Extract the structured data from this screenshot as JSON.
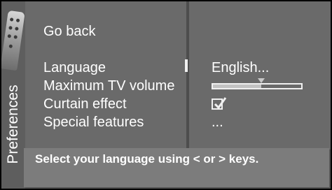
{
  "side_panel": {
    "title": "Preferences",
    "icon": "remote-control-icon"
  },
  "menu": {
    "go_back": "Go back",
    "items": [
      {
        "label": "Language",
        "value": "English..."
      },
      {
        "label": "Maximum TV volume",
        "value_level": 0.55
      },
      {
        "label": "Curtain effect",
        "checked": true
      },
      {
        "label": "Special features",
        "value": "..."
      }
    ]
  },
  "help_text": "Select your language using < or > keys.",
  "colors": {
    "panel": "#6a6a6a",
    "help_bar": "#7c7c7c",
    "text": "#ffffff"
  }
}
